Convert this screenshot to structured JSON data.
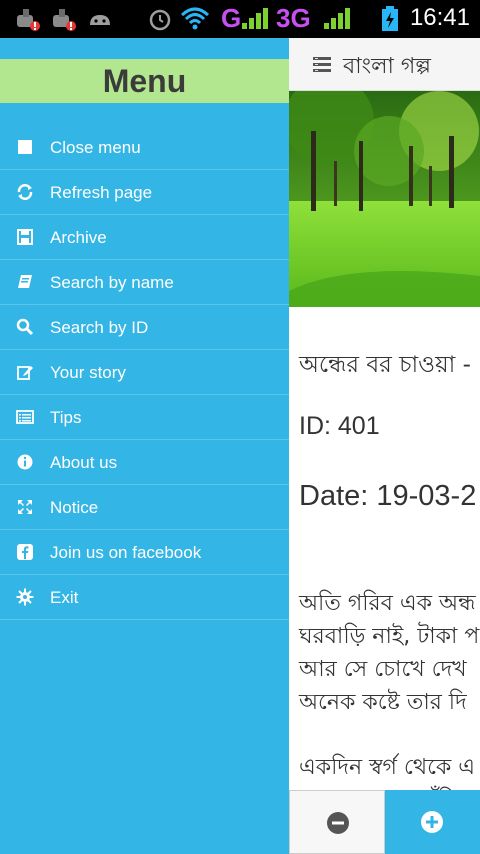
{
  "status_bar": {
    "time": "16:41",
    "network_g": "G",
    "network_3g": "3G"
  },
  "drawer": {
    "title": "Menu",
    "items": [
      {
        "label": "Close menu",
        "icon": "square-icon"
      },
      {
        "label": "Refresh page",
        "icon": "refresh-icon"
      },
      {
        "label": "Archive",
        "icon": "save-icon"
      },
      {
        "label": "Search by name",
        "icon": "book-icon"
      },
      {
        "label": "Search by ID",
        "icon": "search-icon"
      },
      {
        "label": "Your story",
        "icon": "edit-icon"
      },
      {
        "label": "Tips",
        "icon": "list-icon"
      },
      {
        "label": "About us",
        "icon": "info-icon"
      },
      {
        "label": "Notice",
        "icon": "expand-icon"
      },
      {
        "label": "Join us on facebook",
        "icon": "facebook-icon"
      },
      {
        "label": "Exit",
        "icon": "gear-icon"
      }
    ]
  },
  "main": {
    "app_title": "বাংলা গল্প",
    "story_title": "অন্ধের বর চাওয়া -",
    "story_id": "ID: 401",
    "story_date": "Date: 19-03-2",
    "paragraph1": [
      "অতি গরিব এক অন্ধ",
      "ঘরবাড়ি নাই, টাকা প",
      "আর সে চোখে দেখ",
      "অনেক কষ্টে তার দি"
    ],
    "paragraph2": [
      "একদিন স্বর্গ থেকে এ",
      "তারে দেখতে পাঁচি"
    ]
  },
  "colors": {
    "drawer_bg": "#33b5e5",
    "header_bg": "#b2e68f",
    "accent": "#33b5e5"
  }
}
